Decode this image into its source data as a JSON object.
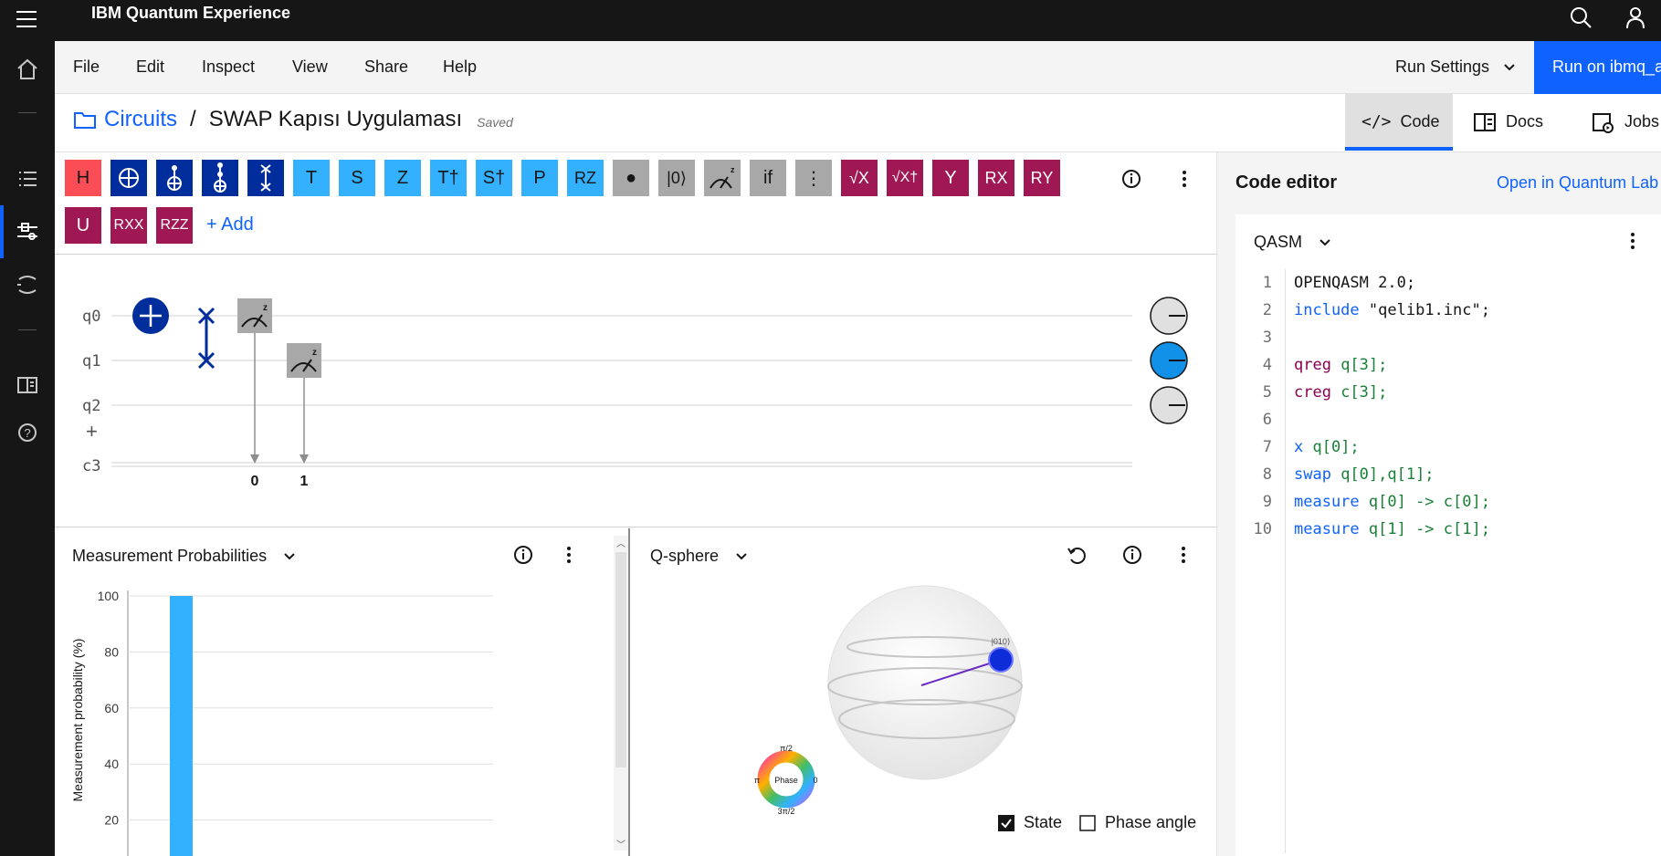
{
  "app": {
    "title": "IBM Quantum Experience"
  },
  "menu": {
    "items": [
      "File",
      "Edit",
      "Inspect",
      "View",
      "Share",
      "Help"
    ],
    "run_settings": "Run Settings",
    "run_button": "Run on ibmq_armonk"
  },
  "breadcrumb": {
    "root": "Circuits",
    "separator": "/",
    "name": "SWAP Kapısı Uygulaması",
    "status": "Saved"
  },
  "view_tabs": [
    {
      "label": "Code",
      "icon": "code-icon",
      "active": true
    },
    {
      "label": "Docs",
      "icon": "docs-icon",
      "active": false
    },
    {
      "label": "Jobs",
      "icon": "jobs-icon",
      "active": false
    }
  ],
  "palette": {
    "row1": [
      {
        "label": "H",
        "color": "red"
      },
      {
        "label": "⊕",
        "color": "navy"
      },
      {
        "label": "CX",
        "color": "navy",
        "glyph": "control-target"
      },
      {
        "label": "CCX",
        "color": "navy",
        "glyph": "double-control-target"
      },
      {
        "label": "SWAP",
        "color": "navy",
        "glyph": "swap"
      },
      {
        "label": "T",
        "color": "cyan"
      },
      {
        "label": "S",
        "color": "cyan"
      },
      {
        "label": "Z",
        "color": "cyan"
      },
      {
        "label": "T†",
        "color": "cyan"
      },
      {
        "label": "S†",
        "color": "cyan"
      },
      {
        "label": "P",
        "color": "cyan"
      },
      {
        "label": "RZ",
        "color": "cyan"
      },
      {
        "label": "●",
        "color": "gray"
      },
      {
        "label": "|0⟩",
        "color": "gray"
      },
      {
        "label": "measure",
        "color": "gray",
        "glyph": "meter"
      },
      {
        "label": "if",
        "color": "gray"
      },
      {
        "label": "⋮",
        "color": "gray"
      },
      {
        "label": "√X",
        "color": "mag"
      },
      {
        "label": "√X†",
        "color": "mag"
      },
      {
        "label": "Y",
        "color": "mag"
      },
      {
        "label": "RX",
        "color": "mag"
      },
      {
        "label": "RY",
        "color": "mag"
      }
    ],
    "row2": [
      {
        "label": "U",
        "color": "mag"
      },
      {
        "label": "RXX",
        "color": "mag"
      },
      {
        "label": "RZZ",
        "color": "mag"
      }
    ],
    "add_label": "+ Add"
  },
  "circuit": {
    "qubits": [
      "q0",
      "q1",
      "q2"
    ],
    "add_qubit": "+",
    "classical": "c3",
    "measure_targets": [
      "0",
      "1"
    ]
  },
  "measurement": {
    "title": "Measurement Probabilities",
    "ylabel": "Measurement probability (%)"
  },
  "chart_data": {
    "type": "bar",
    "title": "Measurement Probabilities",
    "xlabel": "",
    "ylabel": "Measurement probability (%)",
    "ylim": [
      0,
      100
    ],
    "yticks": [
      100,
      80,
      60,
      40,
      20
    ],
    "categories": [
      ""
    ],
    "values": [
      100
    ],
    "color": "#33b1ff"
  },
  "qsphere": {
    "title": "Q-sphere",
    "state_label": "|010⟩",
    "phase_center": "Phase",
    "phase_top": "π/2",
    "phase_left": "π",
    "phase_right": "0",
    "phase_bottom": "3π/2",
    "state_check": "State",
    "phase_check": "Phase angle",
    "state_checked": true,
    "phase_checked": false
  },
  "code": {
    "heading": "Code editor",
    "open_lab": "Open in Quantum Lab",
    "language": "QASM",
    "lines": [
      "OPENQASM 2.0;",
      "include \"qelib1.inc\";",
      "",
      "qreg q[3];",
      "creg c[3];",
      "",
      "x q[0];",
      "swap q[0],q[1];",
      "measure q[0] -> c[0];",
      "measure q[1] -> c[1];"
    ]
  }
}
